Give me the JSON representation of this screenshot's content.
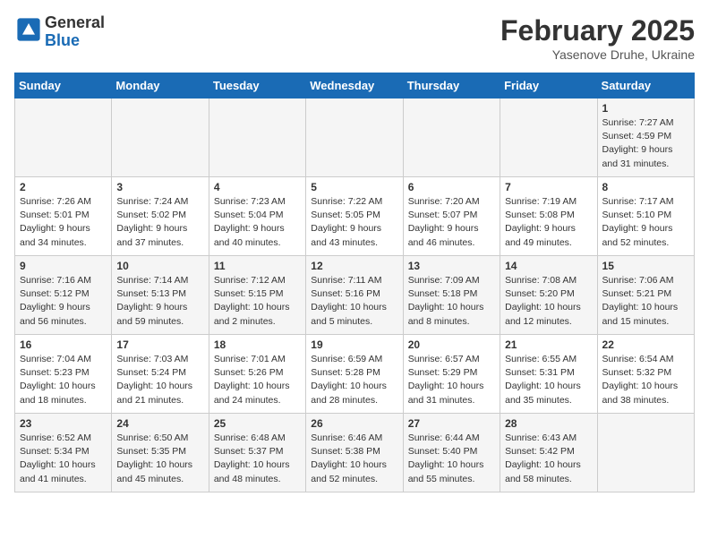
{
  "header": {
    "logo_line1": "General",
    "logo_line2": "Blue",
    "title": "February 2025",
    "subtitle": "Yasenove Druhe, Ukraine"
  },
  "weekdays": [
    "Sunday",
    "Monday",
    "Tuesday",
    "Wednesday",
    "Thursday",
    "Friday",
    "Saturday"
  ],
  "weeks": [
    [
      {
        "day": "",
        "info": ""
      },
      {
        "day": "",
        "info": ""
      },
      {
        "day": "",
        "info": ""
      },
      {
        "day": "",
        "info": ""
      },
      {
        "day": "",
        "info": ""
      },
      {
        "day": "",
        "info": ""
      },
      {
        "day": "1",
        "info": "Sunrise: 7:27 AM\nSunset: 4:59 PM\nDaylight: 9 hours and 31 minutes."
      }
    ],
    [
      {
        "day": "2",
        "info": "Sunrise: 7:26 AM\nSunset: 5:01 PM\nDaylight: 9 hours and 34 minutes."
      },
      {
        "day": "3",
        "info": "Sunrise: 7:24 AM\nSunset: 5:02 PM\nDaylight: 9 hours and 37 minutes."
      },
      {
        "day": "4",
        "info": "Sunrise: 7:23 AM\nSunset: 5:04 PM\nDaylight: 9 hours and 40 minutes."
      },
      {
        "day": "5",
        "info": "Sunrise: 7:22 AM\nSunset: 5:05 PM\nDaylight: 9 hours and 43 minutes."
      },
      {
        "day": "6",
        "info": "Sunrise: 7:20 AM\nSunset: 5:07 PM\nDaylight: 9 hours and 46 minutes."
      },
      {
        "day": "7",
        "info": "Sunrise: 7:19 AM\nSunset: 5:08 PM\nDaylight: 9 hours and 49 minutes."
      },
      {
        "day": "8",
        "info": "Sunrise: 7:17 AM\nSunset: 5:10 PM\nDaylight: 9 hours and 52 minutes."
      }
    ],
    [
      {
        "day": "9",
        "info": "Sunrise: 7:16 AM\nSunset: 5:12 PM\nDaylight: 9 hours and 56 minutes."
      },
      {
        "day": "10",
        "info": "Sunrise: 7:14 AM\nSunset: 5:13 PM\nDaylight: 9 hours and 59 minutes."
      },
      {
        "day": "11",
        "info": "Sunrise: 7:12 AM\nSunset: 5:15 PM\nDaylight: 10 hours and 2 minutes."
      },
      {
        "day": "12",
        "info": "Sunrise: 7:11 AM\nSunset: 5:16 PM\nDaylight: 10 hours and 5 minutes."
      },
      {
        "day": "13",
        "info": "Sunrise: 7:09 AM\nSunset: 5:18 PM\nDaylight: 10 hours and 8 minutes."
      },
      {
        "day": "14",
        "info": "Sunrise: 7:08 AM\nSunset: 5:20 PM\nDaylight: 10 hours and 12 minutes."
      },
      {
        "day": "15",
        "info": "Sunrise: 7:06 AM\nSunset: 5:21 PM\nDaylight: 10 hours and 15 minutes."
      }
    ],
    [
      {
        "day": "16",
        "info": "Sunrise: 7:04 AM\nSunset: 5:23 PM\nDaylight: 10 hours and 18 minutes."
      },
      {
        "day": "17",
        "info": "Sunrise: 7:03 AM\nSunset: 5:24 PM\nDaylight: 10 hours and 21 minutes."
      },
      {
        "day": "18",
        "info": "Sunrise: 7:01 AM\nSunset: 5:26 PM\nDaylight: 10 hours and 24 minutes."
      },
      {
        "day": "19",
        "info": "Sunrise: 6:59 AM\nSunset: 5:28 PM\nDaylight: 10 hours and 28 minutes."
      },
      {
        "day": "20",
        "info": "Sunrise: 6:57 AM\nSunset: 5:29 PM\nDaylight: 10 hours and 31 minutes."
      },
      {
        "day": "21",
        "info": "Sunrise: 6:55 AM\nSunset: 5:31 PM\nDaylight: 10 hours and 35 minutes."
      },
      {
        "day": "22",
        "info": "Sunrise: 6:54 AM\nSunset: 5:32 PM\nDaylight: 10 hours and 38 minutes."
      }
    ],
    [
      {
        "day": "23",
        "info": "Sunrise: 6:52 AM\nSunset: 5:34 PM\nDaylight: 10 hours and 41 minutes."
      },
      {
        "day": "24",
        "info": "Sunrise: 6:50 AM\nSunset: 5:35 PM\nDaylight: 10 hours and 45 minutes."
      },
      {
        "day": "25",
        "info": "Sunrise: 6:48 AM\nSunset: 5:37 PM\nDaylight: 10 hours and 48 minutes."
      },
      {
        "day": "26",
        "info": "Sunrise: 6:46 AM\nSunset: 5:38 PM\nDaylight: 10 hours and 52 minutes."
      },
      {
        "day": "27",
        "info": "Sunrise: 6:44 AM\nSunset: 5:40 PM\nDaylight: 10 hours and 55 minutes."
      },
      {
        "day": "28",
        "info": "Sunrise: 6:43 AM\nSunset: 5:42 PM\nDaylight: 10 hours and 58 minutes."
      },
      {
        "day": "",
        "info": ""
      }
    ]
  ]
}
